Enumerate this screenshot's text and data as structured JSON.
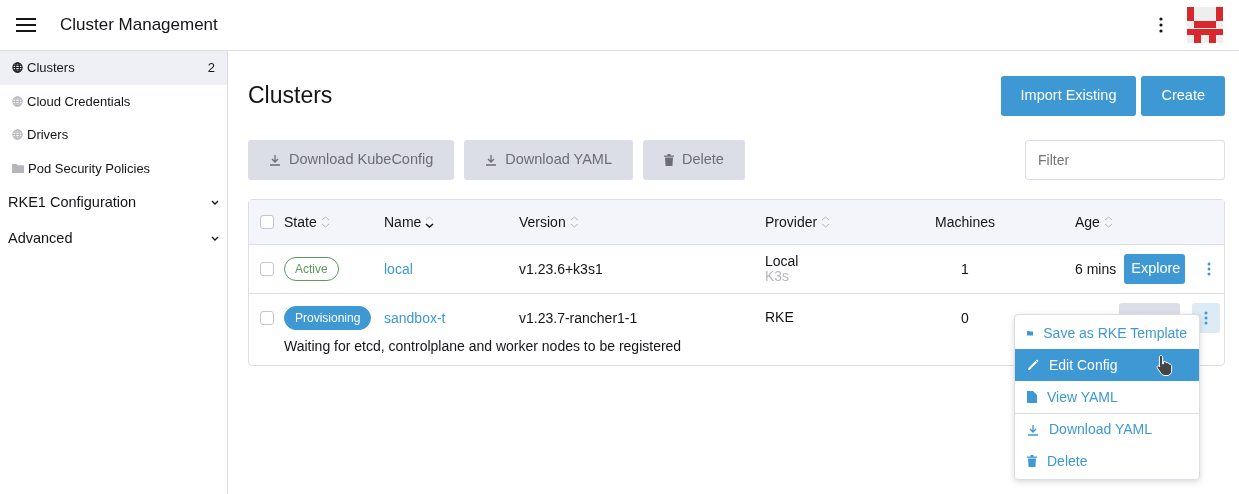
{
  "header": {
    "title": "Cluster Management"
  },
  "sidebar": {
    "items": [
      {
        "label": "Clusters",
        "count": "2",
        "selected": true
      },
      {
        "label": "Cloud Credentials",
        "selected": false
      },
      {
        "label": "Drivers",
        "selected": false
      },
      {
        "label": "Pod Security Policies",
        "selected": false
      }
    ],
    "groups": [
      {
        "label": "RKE1 Configuration",
        "expanded": false
      },
      {
        "label": "Advanced",
        "expanded": false
      }
    ]
  },
  "page": {
    "title": "Clusters",
    "actions": [
      "Import Existing",
      "Create"
    ],
    "bulk_actions": [
      {
        "label": "Download KubeConfig",
        "disabled": true
      },
      {
        "label": "Download YAML",
        "disabled": true
      },
      {
        "label": "Delete",
        "disabled": true
      }
    ],
    "filter": {
      "placeholder": "Filter"
    }
  },
  "table": {
    "select_all_checked": false,
    "columns": [
      {
        "label": "State",
        "sortable": true,
        "sorted": false
      },
      {
        "label": "Name",
        "sortable": true,
        "sorted": true
      },
      {
        "label": "Version",
        "sortable": true,
        "sorted": false
      },
      {
        "label": "Provider",
        "sortable": true,
        "sorted": false
      },
      {
        "label": "Machines",
        "sortable": false
      },
      {
        "label": "Age",
        "sortable": true,
        "sorted": false
      }
    ],
    "rows": [
      {
        "checked": false,
        "state": "Active",
        "kind": "active",
        "name": "local",
        "version": "v1.23.6+k3s1",
        "provider": "Local",
        "provider_detail": "K3s",
        "machines": "1",
        "age": "6 mins",
        "explore": "Explore",
        "explore_disabled": false,
        "menu_open": false
      },
      {
        "checked": false,
        "state": "Provisioning",
        "kind": "provisioning",
        "name": "sandbox-t",
        "version": "v1.23.7-rancher1-1",
        "provider": "RKE",
        "machines": "0",
        "explore_disabled": true,
        "menu_open": true,
        "message": "Waiting for etcd, controlplane and worker nodes to be registered"
      }
    ]
  },
  "menu": {
    "items": [
      {
        "label": "Save as RKE Template",
        "selected": false,
        "divider_before": false
      },
      {
        "label": "Edit Config",
        "selected": true,
        "divider_before": false
      },
      {
        "label": "View YAML",
        "selected": false,
        "divider_before": false
      },
      {
        "label": "Download YAML",
        "selected": false,
        "divider_before": true
      },
      {
        "label": "Delete",
        "selected": false,
        "divider_before": false
      }
    ]
  }
}
